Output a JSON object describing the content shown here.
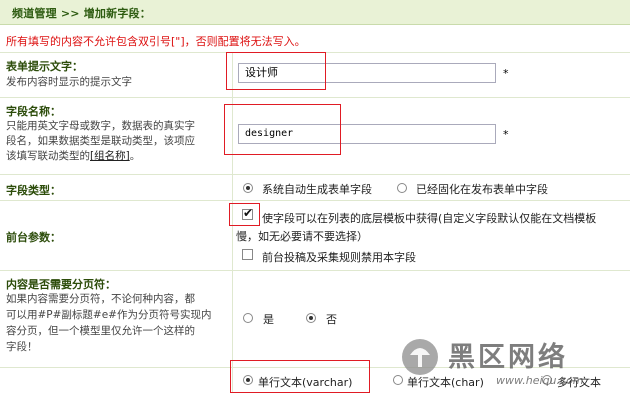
{
  "breadcrumb": {
    "section": "频道管理",
    "sep": ">>",
    "current": "增加新字段："
  },
  "warning": "所有填写的内容不允许包含双引号[\"]，否则配置将无法写入。",
  "form_tip": {
    "label": "表单提示文字：",
    "desc": "发布内容时显示的提示文字",
    "value": "设计师",
    "required": "*"
  },
  "field_name": {
    "label": "字段名称：",
    "desc_1": "只能用英文字母或数字，数据表的真实字",
    "desc_2": "段名，如果数据类型是联动类型，该项应",
    "desc_3_prefix": "该填写联动类型的",
    "desc_link": "[组名称]",
    "desc_3_suffix": "。",
    "value": "designer",
    "required": "*"
  },
  "field_type": {
    "label": "字段类型：",
    "options": [
      "系统自动生成表单字段",
      "已经固化在发布表单中字段"
    ],
    "selected": 0
  },
  "frontend": {
    "label": "前台参数：",
    "opt1_line1": "使字段可以在列表的底层模板中获得(自定义字段默认仅能在文档模板",
    "opt1_line2": "慢，如无必要请不要选择）",
    "opt1_checked": true,
    "opt2": "前台投稿及采集规则禁用本字段",
    "opt2_checked": false
  },
  "pagination": {
    "label": "内容是否需要分页符：",
    "desc_1": "如果内容需要分页符，不论何种内容，都",
    "desc_2": "可以用#P#副标题#e#作为分页符号实现内",
    "desc_3": "容分页，但一个模型里仅允许一个这样的",
    "desc_4": "字段！",
    "yes": "是",
    "no": "否",
    "selected": "no"
  },
  "data_type": {
    "options": [
      "单行文本(varchar)",
      "单行文本(char)",
      "多行文本"
    ],
    "selected": 0
  },
  "watermark": {
    "brand": "黑区网络",
    "url": "www.heiqu.com"
  },
  "colors": {
    "accent": "#e01b24",
    "title_bg": "#e9f2d6",
    "label": "#2c4c0a"
  }
}
